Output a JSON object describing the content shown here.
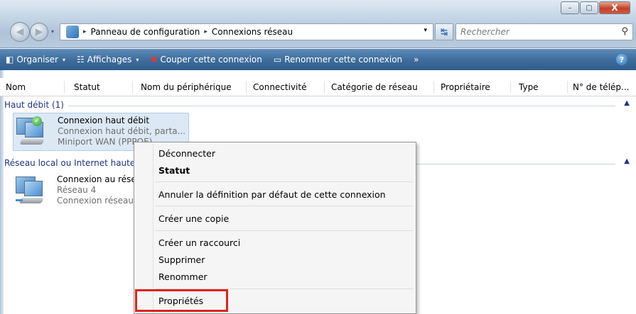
{
  "window": {
    "minimize_glyph": "–",
    "maximize_glyph": "▢",
    "close_glyph": "X"
  },
  "address": {
    "path": [
      "Panneau de configuration",
      "Connexions réseau"
    ],
    "separator": "▸",
    "dropdown_glyph": "▾",
    "refresh_glyph": "↹"
  },
  "search": {
    "placeholder": "Rechercher",
    "icon_glyph": "⚲"
  },
  "commands": [
    {
      "label": "Organiser",
      "icon": "organize-icon",
      "glyph": "◧",
      "caret": "▾"
    },
    {
      "label": "Affichages",
      "icon": "views-icon",
      "glyph": "☷",
      "caret": "▾"
    },
    {
      "label": "Couper cette connexion",
      "icon": "disconnect-icon",
      "glyph": "✖",
      "caret": ""
    },
    {
      "label": "Renommer cette connexion",
      "icon": "rename-icon",
      "glyph": "▭",
      "caret": ""
    },
    {
      "label": "»",
      "icon": "more-icon",
      "glyph": "",
      "caret": ""
    }
  ],
  "help_glyph": "?",
  "columns": [
    "Nom",
    "Statut",
    "Nom du périphérique",
    "Connectivité",
    "Catégorie de réseau",
    "Propriétaire",
    "Type",
    "N° de télép..."
  ],
  "groups": [
    {
      "label": "Haut débit (1)",
      "collapse_glyph": "▲",
      "item": {
        "name": "Connexion haut débit",
        "line2": "Connexion haut débit, parta...",
        "line3": "Miniport WAN (PPPOE)"
      }
    },
    {
      "label": "Réseau local ou Internet haute vitesse",
      "collapse_glyph": "▲",
      "item": {
        "name": "Connexion au réseau local",
        "line2": "Réseau 4",
        "line3": "Connexion réseau Intel(R)"
      }
    }
  ],
  "context_menu": {
    "items": [
      {
        "label": "Déconnecter",
        "bold": false
      },
      {
        "label": "Statut",
        "bold": true
      },
      {
        "label": "Annuler la définition par défaut de cette connexion",
        "bold": false
      },
      {
        "label": "Créer une copie",
        "bold": false
      },
      {
        "label": "Créer un raccourci",
        "bold": false
      },
      {
        "label": "Supprimer",
        "bold": false
      },
      {
        "label": "Renommer",
        "bold": false
      },
      {
        "label": "Propriétés",
        "bold": false
      }
    ]
  },
  "colors": {
    "command_bar": "#3f6e9d",
    "group_label": "#1e3287",
    "selection": "#dce9f5",
    "highlight_box": "#e0231e"
  }
}
